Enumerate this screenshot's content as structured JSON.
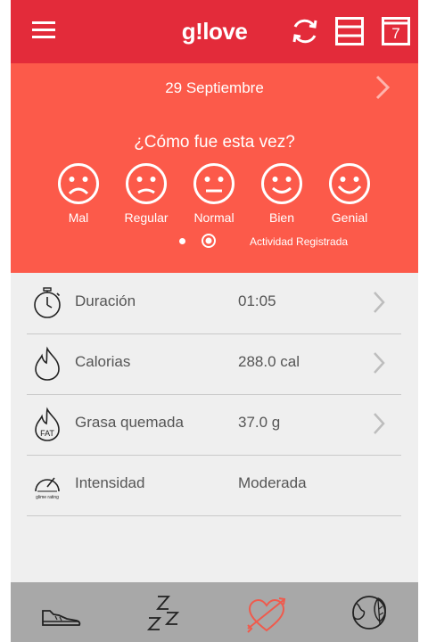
{
  "header": {
    "menu_icon": "hamburger-menu-icon",
    "title_prefix": "g",
    "title_mark": "!",
    "title_suffix": "love",
    "sync_icon": "sync-icon",
    "list_icon": "list-view-icon",
    "calendar_icon": "calendar-icon",
    "calendar_day": "7"
  },
  "hero": {
    "date": "29 Septiembre",
    "question": "¿Cómo fue esta vez?",
    "moods": [
      {
        "label": "Mal",
        "icon": "very-sad-face-icon"
      },
      {
        "label": "Regular",
        "icon": "sad-face-icon"
      },
      {
        "label": "Normal",
        "icon": "neutral-face-icon"
      },
      {
        "label": "Bien",
        "icon": "smile-face-icon"
      },
      {
        "label": "Genial",
        "icon": "big-smile-face-icon"
      }
    ],
    "activity_text": "Actividad Registrada"
  },
  "stats": [
    {
      "label": "Duración",
      "value": "01:05",
      "icon": "stopwatch-icon",
      "has_arrow": true
    },
    {
      "label": "Calorias",
      "value": "288.0  cal",
      "icon": "flame-icon",
      "has_arrow": true
    },
    {
      "label": "Grasa quemada",
      "value": "37.0  g",
      "icon": "fat-flame-icon",
      "fat_text": "FAT",
      "has_arrow": true
    },
    {
      "label": "Intensidad",
      "value": "Moderada",
      "icon": "gauge-icon",
      "gauge_text": "glime rating",
      "has_arrow": false
    }
  ],
  "bottom_nav": [
    {
      "icon": "sneaker-icon",
      "active": false
    },
    {
      "icon": "sleep-zzz-icon",
      "active": false
    },
    {
      "icon": "heart-arrow-icon",
      "active": true
    },
    {
      "icon": "globe-leaf-icon",
      "active": false
    }
  ],
  "colors": {
    "topbar": "#e32b3a",
    "hero": "#fc5a4a",
    "background": "#efefef",
    "bottombar": "#a8a8a8",
    "active_nav": "#f05a4c"
  }
}
